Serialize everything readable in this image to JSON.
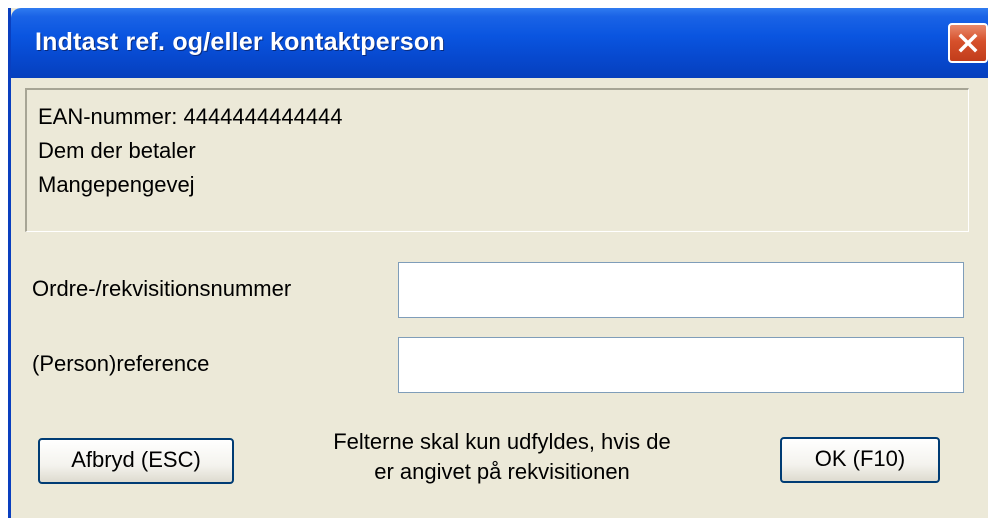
{
  "window": {
    "title": "Indtast ref. og/eller kontaktperson"
  },
  "info": {
    "ean_line": "EAN-nummer: 4444444444444",
    "payer_name": "Dem der betaler",
    "address": "Mangepengevej"
  },
  "form": {
    "order_label": "Ordre-/rekvisitionsnummer",
    "order_value": "",
    "reference_label": "(Person)reference",
    "reference_value": ""
  },
  "footer": {
    "cancel_label": "Afbryd (ESC)",
    "note_line1": "Felterne skal kun udfyldes, hvis de",
    "note_line2": "er angivet på rekvisitionen",
    "ok_label": "OK (F10)"
  },
  "colors": {
    "titlebar": "#0a55e0",
    "dialog_bg": "#ece9d8",
    "close_button": "#d6502b",
    "button_border": "#003c74"
  },
  "icons": {
    "close": "close-x-icon"
  }
}
